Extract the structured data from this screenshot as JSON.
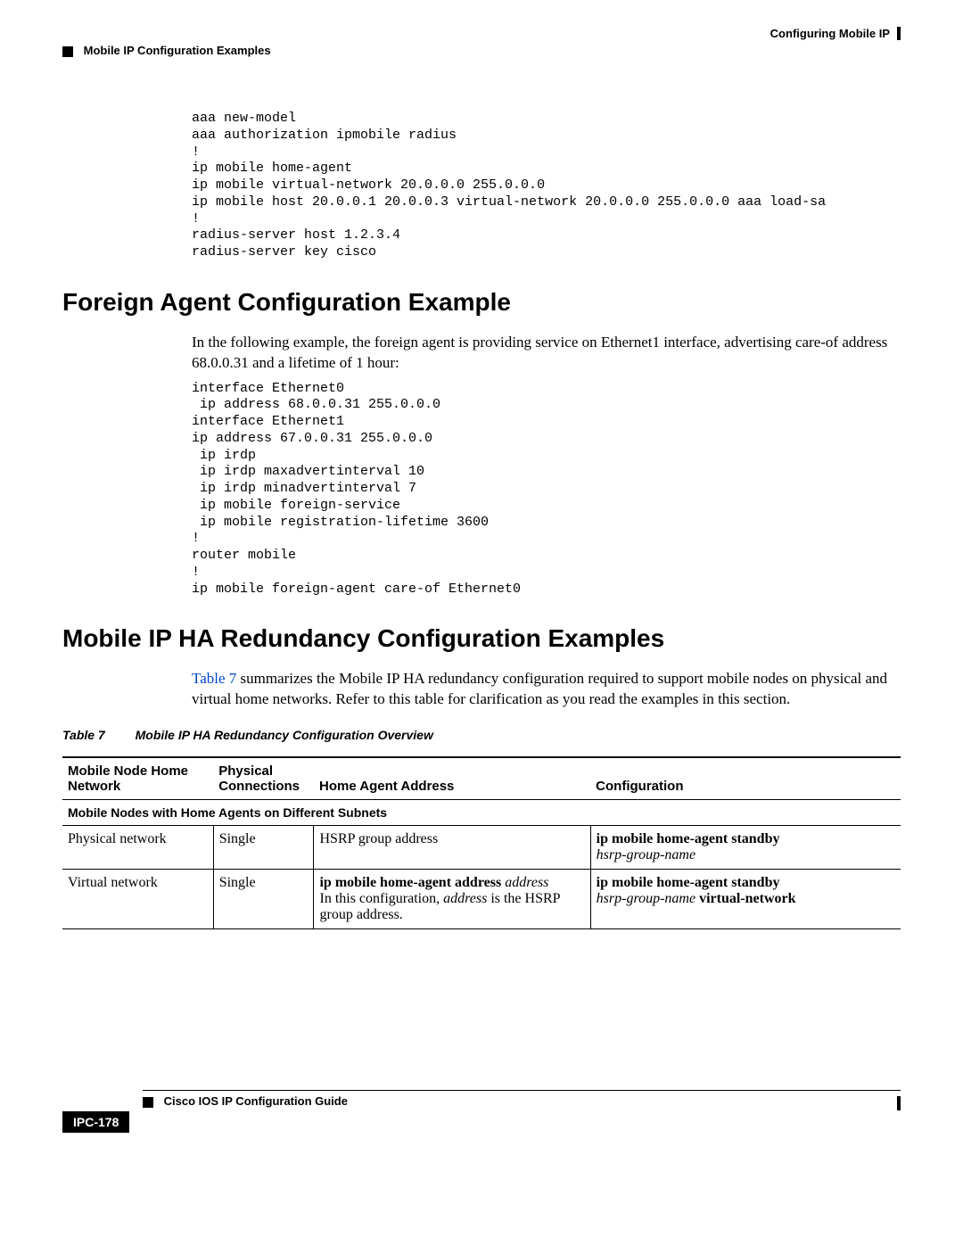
{
  "header": {
    "right": "Configuring Mobile IP",
    "left": "Mobile IP Configuration Examples"
  },
  "code1": "aaa new-model\naaa authorization ipmobile radius\n!\nip mobile home-agent\nip mobile virtual-network 20.0.0.0 255.0.0.0\nip mobile host 20.0.0.1 20.0.0.3 virtual-network 20.0.0.0 255.0.0.0 aaa load-sa\n!\nradius-server host 1.2.3.4\nradius-server key cisco",
  "section1": {
    "heading": "Foreign Agent Configuration Example",
    "body": "In the following example, the foreign agent is providing service on Ethernet1 interface, advertising care-of address 68.0.0.31 and a lifetime of 1 hour:"
  },
  "code2": "interface Ethernet0\n ip address 68.0.0.31 255.0.0.0\ninterface Ethernet1\nip address 67.0.0.31 255.0.0.0\n ip irdp\n ip irdp maxadvertinterval 10\n ip irdp minadvertinterval 7\n ip mobile foreign-service\n ip mobile registration-lifetime 3600\n!\nrouter mobile\n!\nip mobile foreign-agent care-of Ethernet0",
  "section2": {
    "heading": "Mobile IP HA Redundancy Configuration Examples",
    "body_pre": "",
    "link_text": "Table 7",
    "body_post": " summarizes the Mobile IP HA redundancy configuration required to support mobile nodes on physical and virtual home networks. Refer to this table for clarification as you read the examples in this section."
  },
  "table": {
    "caption_label": "Table 7",
    "caption_title": "Mobile IP HA Redundancy Configuration Overview",
    "headers": {
      "c1": "Mobile Node Home Network",
      "c2": "Physical Connections",
      "c3": "Home Agent Address",
      "c4": "Configuration"
    },
    "subhead": "Mobile Nodes with Home Agents on Different Subnets",
    "rows": [
      {
        "c1": "Physical network",
        "c2": "Single",
        "c3": "HSRP group address",
        "c4_bold": "ip mobile home-agent standby",
        "c4_ital": "hsrp-group-name",
        "c4_bold2": ""
      },
      {
        "c1": "Virtual network",
        "c2": "Single",
        "c3_bold": "ip mobile home-agent address",
        "c3_ital": "address",
        "c3_note_pre": "In this configuration, ",
        "c3_note_ital": "address",
        "c3_note_post": " is the HSRP group address.",
        "c4_bold": "ip mobile home-agent standby",
        "c4_ital": "hsrp-group-name",
        "c4_bold2": " virtual-network"
      }
    ]
  },
  "footer": {
    "title": "Cisco IOS IP Configuration Guide",
    "pagenum": "IPC-178"
  }
}
